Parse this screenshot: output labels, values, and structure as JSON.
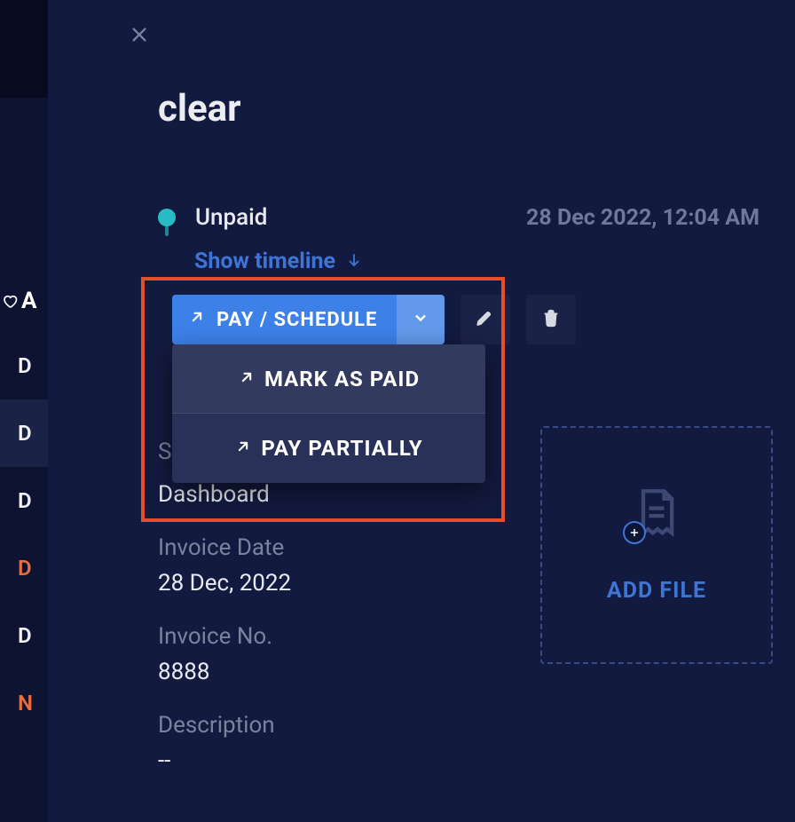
{
  "left": {
    "ac_prefix": "A",
    "items": [
      "D",
      "D",
      "D",
      "D",
      "D",
      "N"
    ]
  },
  "panel": {
    "title": "clear",
    "status": {
      "label": "Unpaid",
      "timestamp": "28 Dec 2022, 12:04 AM",
      "show_timeline": "Show timeline"
    },
    "actions": {
      "primary": "PAY / SCHEDULE",
      "menu": [
        "MARK AS PAID",
        "PAY PARTIALLY"
      ]
    },
    "details": {
      "s_partial": "S",
      "dashboard_value": "Dashboard",
      "invoice_date_label": "Invoice Date",
      "invoice_date_value": "28 Dec, 2022",
      "invoice_no_label": "Invoice No.",
      "invoice_no_value": "8888",
      "description_label": "Description",
      "description_value": "--"
    },
    "dropzone": {
      "label": "ADD FILE"
    }
  }
}
